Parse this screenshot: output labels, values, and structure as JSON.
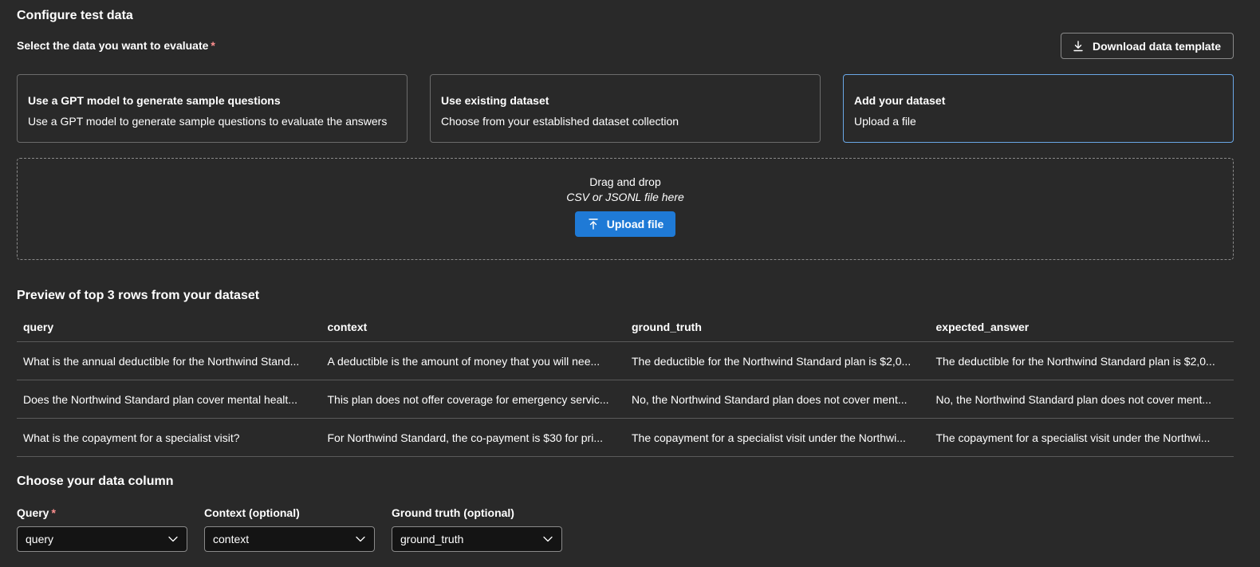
{
  "header": {
    "title": "Configure test data",
    "select_label": "Select the data you want to evaluate",
    "required_mark": "*",
    "download_label": "Download data template"
  },
  "options": [
    {
      "title": "Use a GPT model to generate sample questions",
      "desc": "Use a GPT model to generate sample questions to evaluate the answers",
      "selected": false
    },
    {
      "title": "Use existing dataset",
      "desc": "Choose from your established dataset collection",
      "selected": false
    },
    {
      "title": "Add your dataset",
      "desc": "Upload a file",
      "selected": true
    }
  ],
  "dropzone": {
    "line1": "Drag and drop",
    "line2": "CSV or JSONL file here",
    "upload_label": "Upload file"
  },
  "preview": {
    "title": "Preview of top 3 rows from your dataset",
    "columns": [
      "query",
      "context",
      "ground_truth",
      "expected_answer"
    ],
    "rows": [
      [
        "What is the annual deductible for the Northwind Stand...",
        "A deductible is the amount of money that you will nee...",
        "The deductible for the Northwind Standard plan is $2,0...",
        "The deductible for the Northwind Standard plan is $2,0..."
      ],
      [
        "Does the Northwind Standard plan cover mental healt...",
        "This plan does not offer coverage for emergency servic...",
        "No, the Northwind Standard plan does not cover ment...",
        "No, the Northwind Standard plan does not cover ment..."
      ],
      [
        "What is the copayment for a specialist visit?",
        "For Northwind Standard, the co-payment is $30 for pri...",
        "The copayment for a specialist visit under the Northwi...",
        "The copayment for a specialist visit under the Northwi..."
      ]
    ]
  },
  "columns_section": {
    "title": "Choose your data column",
    "fields": [
      {
        "label": "Query",
        "required": true,
        "value": "query"
      },
      {
        "label": "Context (optional)",
        "required": false,
        "value": "context"
      },
      {
        "label": "Ground truth (optional)",
        "required": false,
        "value": "ground_truth"
      }
    ]
  },
  "icons": {
    "download": "download-icon",
    "upload": "upload-icon",
    "dropdown": "chevron-down-icon"
  },
  "colors": {
    "background": "#292929",
    "accent": "#1f7ad6",
    "selected_border": "#6aa7e6",
    "required": "#ff8f8f"
  }
}
